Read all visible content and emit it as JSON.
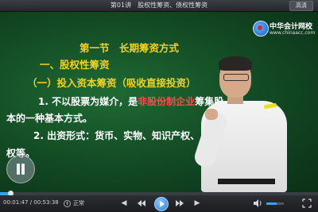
{
  "topbar": {
    "title": "第01讲　股权性筹资、债权性筹资",
    "hd_label": "高清"
  },
  "logo": {
    "name": "中华会计网校",
    "url": "www.chinaacc.com"
  },
  "slide": {
    "section_title": "第一节　长期筹资方式",
    "heading1": "一、股权性筹资",
    "heading2": "（一）投入资本筹资（吸收直接投资）",
    "p1_prefix": "1. 不以股票为媒介，是",
    "p1_highlight": "非股份制企业",
    "p1_suffix": "筹集股",
    "p2": "本的一种基本方式。",
    "p3": "2. 出资形式：货币、实物、知识产权、",
    "p4": "权等。"
  },
  "player": {
    "current_time": "00:01:47",
    "separator": "/",
    "total_time": "00:53:38",
    "progress": 0.033,
    "speed_label": "正常",
    "volume": 0.6,
    "accent_color": "#3aa0ff"
  },
  "icons": {
    "prev": "◀",
    "next": "▶",
    "volume": "🔊",
    "fullscreen": "⛶"
  }
}
